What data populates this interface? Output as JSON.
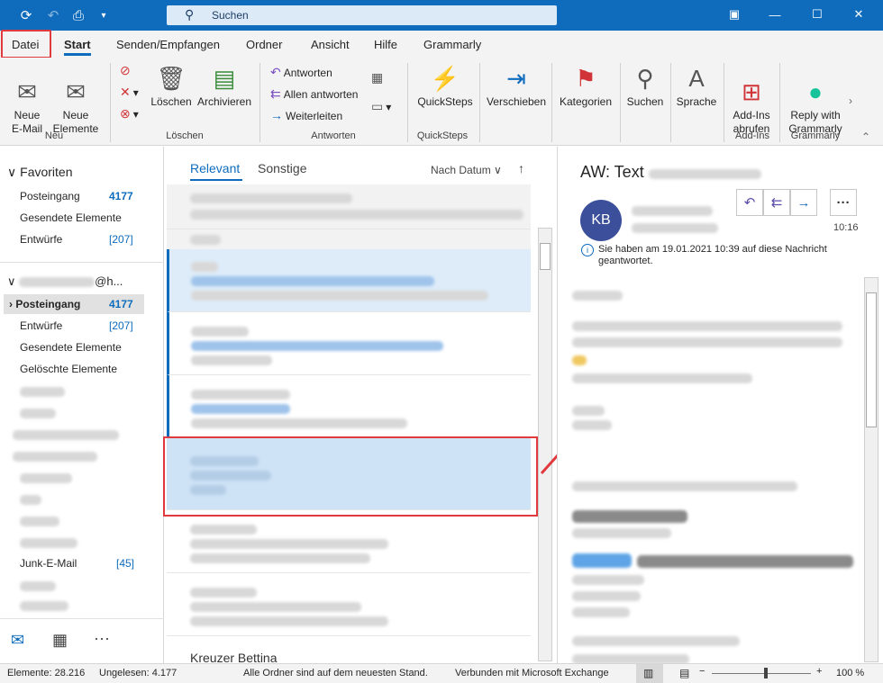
{
  "titlebar": {
    "search_label": "Suchen"
  },
  "menu": {
    "tabs": [
      "Datei",
      "Start",
      "Senden/Empfangen",
      "Ordner",
      "Ansicht",
      "Hilfe",
      "Grammarly"
    ]
  },
  "ribbon": {
    "neue_email": "Neue\nE-Mail",
    "neue_elemente": "Neue\nElemente",
    "loeschen": "Löschen",
    "archivieren": "Archivieren",
    "antworten": "Antworten",
    "allen_antworten": "Allen antworten",
    "weiterleiten": "Weiterleiten",
    "quicksteps": "QuickSteps",
    "verschieben": "Verschieben",
    "kategorien": "Kategorien",
    "suchen": "Suchen",
    "sprache": "Sprache",
    "addins_abrufen": "Add-Ins\nabrufen",
    "reply_grammarly": "Reply with\nGrammarly",
    "groups": {
      "neu": "Neu",
      "loeschen": "Löschen",
      "antworten": "Antworten",
      "quicksteps": "QuickSteps",
      "addins": "Add-Ins",
      "grammarly": "Grammarly"
    }
  },
  "nav": {
    "favoriten": "Favoriten",
    "fav_posteingang": "Posteingang",
    "fav_posteingang_count": "4177",
    "fav_gesendete": "Gesendete Elemente",
    "fav_entwuerfe": "Entwürfe",
    "fav_entwuerfe_count": "[207]",
    "account_suffix": "@h...",
    "posteingang": "Posteingang",
    "posteingang_count": "4177",
    "entwuerfe": "Entwürfe",
    "entwuerfe_count": "[207]",
    "gesendete": "Gesendete Elemente",
    "geloeschte": "Gelöschte Elemente",
    "junk": "Junk-E-Mail",
    "junk_count": "[45]"
  },
  "list": {
    "tab_relevant": "Relevant",
    "tab_sonstige": "Sonstige",
    "sort": "Nach Datum",
    "partial_sender": "Kreuzer Bettina"
  },
  "reading": {
    "subject": "AW: Text",
    "avatar": "KB",
    "time": "10:16",
    "info": "Sie haben am 19.01.2021 10:39 auf diese Nachricht geantwortet."
  },
  "status": {
    "elemente": "Elemente: 28.216",
    "ungelesen": "Ungelesen: 4.177",
    "ordner": "Alle Ordner sind auf dem neuesten Stand.",
    "verbunden": "Verbunden mit Microsoft Exchange",
    "zoom": "100 %"
  },
  "colors": {
    "accent": "#0f6cbd",
    "highlight": "#e0393e",
    "selected_row": "#cfe3f6"
  }
}
